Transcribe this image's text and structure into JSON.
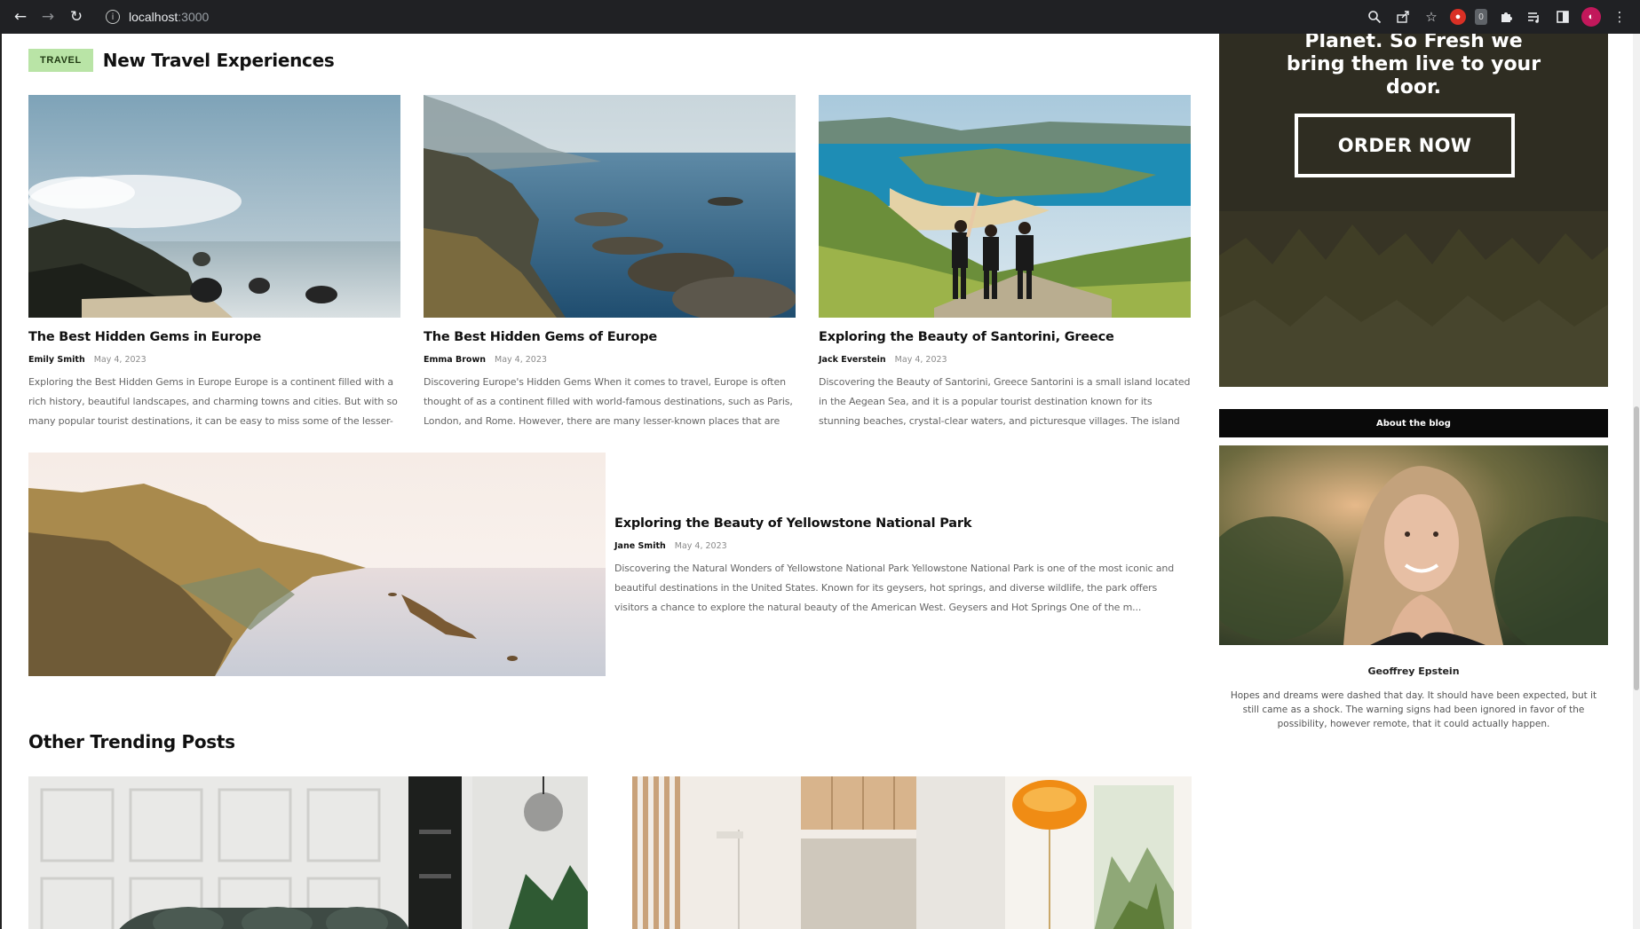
{
  "browser": {
    "url_host": "localhost",
    "url_port": ":3000",
    "icons": [
      "back-arrow-icon",
      "forward-arrow-icon",
      "reload-icon",
      "info-icon",
      "zoom-icon",
      "share-icon",
      "star-icon",
      "extension-icon",
      "extension-counter-icon",
      "puzzle-icon",
      "media-icon",
      "sidebar-icon",
      "profile-icon",
      "menu-dots-icon"
    ],
    "ext_counter": "0"
  },
  "travel": {
    "tag": "TRAVEL",
    "title": "New Travel Experiences",
    "cards": [
      {
        "title": "The Best Hidden Gems in Europe",
        "author": "Emily Smith",
        "date": "May 4, 2023",
        "excerpt": "Exploring the Best Hidden Gems in Europe Europe is a continent filled with a rich history, beautiful landscapes, and charming towns and cities. But with so many popular tourist destinations, it can be easy to miss some of the lesser-known..."
      },
      {
        "title": "The Best Hidden Gems of Europe",
        "author": "Emma Brown",
        "date": "May 4, 2023",
        "excerpt": "Discovering Europe's Hidden Gems When it comes to travel, Europe is often thought of as a continent filled with world-famous destinations, such as Paris, London, and Rome. However, there are many lesser-known places that are just ..."
      },
      {
        "title": "Exploring the Beauty of Santorini, Greece",
        "author": "Jack Everstein",
        "date": "May 4, 2023",
        "excerpt": "Discovering the Beauty of Santorini, Greece Santorini is a small island located in the Aegean Sea, and it is a popular tourist destination known for its stunning beaches, crystal-clear waters, and picturesque villages. The island has become..."
      }
    ],
    "featured": {
      "title": "Exploring the Beauty of Yellowstone National Park",
      "author": "Jane Smith",
      "date": "May 4, 2023",
      "excerpt": "Discovering the Natural Wonders of Yellowstone National Park Yellowstone National Park is one of the most iconic and beautiful destinations in the United States. Known for its geysers, hot springs, and diverse wildlife, the park offers visitors a chance to explore the natural beauty of the American West. Geysers and Hot Springs One of the m..."
    }
  },
  "trending": {
    "title": "Other Trending Posts"
  },
  "sidebar": {
    "ad_text": "Planet. So Fresh we bring them live to your door.",
    "order_button": "ORDER NOW",
    "about_header": "About the blog",
    "author_name": "Geoffrey Epstein",
    "author_bio": "Hopes and dreams were dashed that day. It should have been expected, but it still came as a shock. The warning signs had been ignored in favor of the possibility, however remote, that it could actually happen."
  }
}
